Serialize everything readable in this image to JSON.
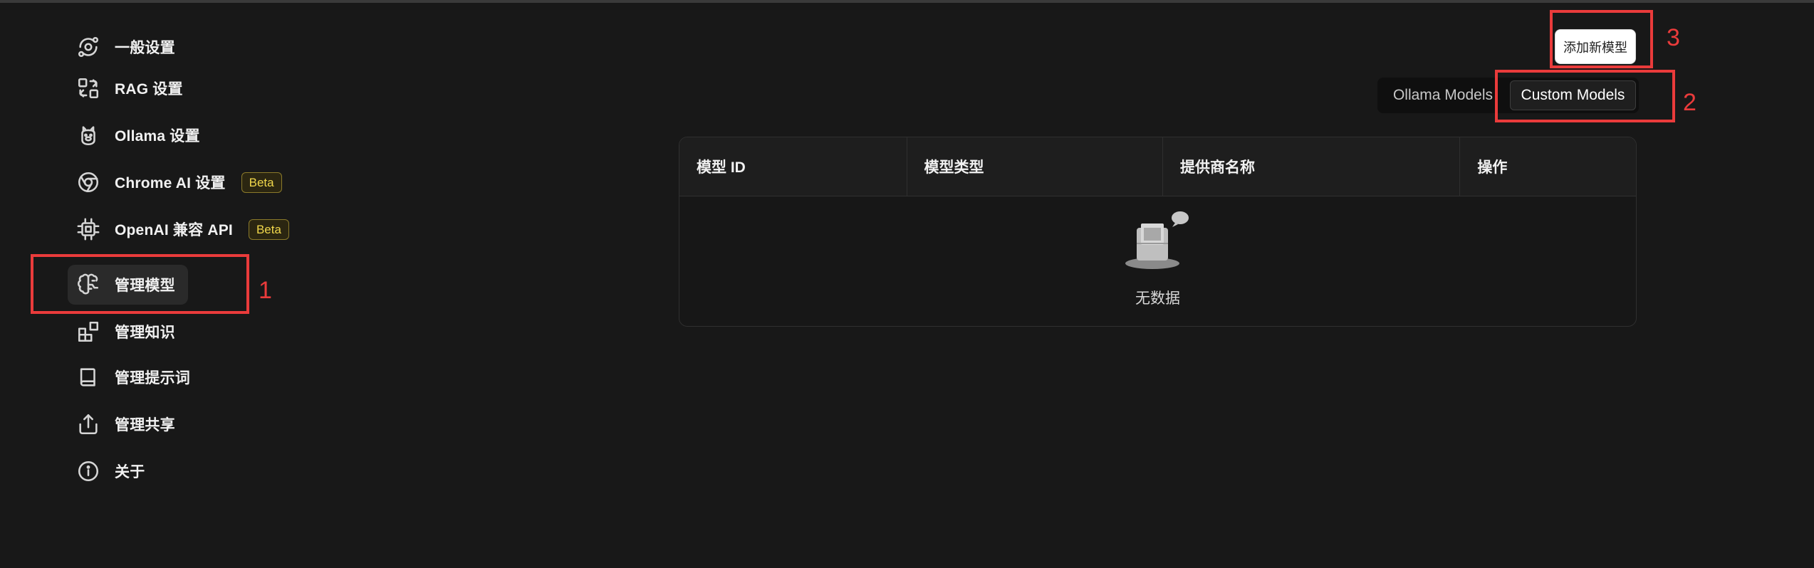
{
  "sidebar": {
    "items": [
      {
        "label": "一般设置",
        "icon": "orbit-icon"
      },
      {
        "label": "RAG 设置",
        "icon": "combine-icon"
      },
      {
        "label": "Ollama 设置",
        "icon": "llama-icon"
      },
      {
        "label": "Chrome AI 设置",
        "icon": "chrome-icon",
        "badge": "Beta"
      },
      {
        "label": "OpenAI 兼容 API",
        "icon": "cpu-icon",
        "badge": "Beta"
      },
      {
        "label": "管理模型",
        "icon": "brain-icon",
        "active": true
      },
      {
        "label": "管理知识",
        "icon": "blocks-icon"
      },
      {
        "label": "管理提示词",
        "icon": "book-icon"
      },
      {
        "label": "管理共享",
        "icon": "share-icon"
      },
      {
        "label": "关于",
        "icon": "info-icon"
      }
    ]
  },
  "toolbar": {
    "add_model_label": "添加新模型",
    "tabs": [
      {
        "label": "Ollama Models",
        "active": false
      },
      {
        "label": "Custom Models",
        "active": true
      }
    ]
  },
  "table": {
    "columns": [
      "模型 ID",
      "模型类型",
      "提供商名称",
      "操作"
    ],
    "empty_text": "无数据"
  },
  "annotations": {
    "one": "1",
    "two": "2",
    "three": "3"
  },
  "colors": {
    "background": "#181818",
    "annotation": "#ea3b3b",
    "badge_text": "#f0d74b"
  }
}
